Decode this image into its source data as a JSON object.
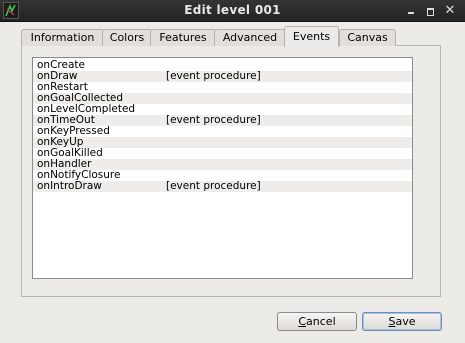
{
  "window": {
    "title": "Edit level 001",
    "icons": [
      "app-icon",
      "minimize-icon",
      "maximize-icon",
      "close-icon"
    ]
  },
  "tabs": [
    {
      "label": "Information",
      "active": false
    },
    {
      "label": "Colors",
      "active": false
    },
    {
      "label": "Features",
      "active": false
    },
    {
      "label": "Advanced",
      "active": false
    },
    {
      "label": "Events",
      "active": true
    },
    {
      "label": "Canvas",
      "active": false
    }
  ],
  "events": [
    {
      "name": "onCreate",
      "procedure": ""
    },
    {
      "name": "onDraw",
      "procedure": "[event procedure]"
    },
    {
      "name": "onRestart",
      "procedure": ""
    },
    {
      "name": "onGoalCollected",
      "procedure": ""
    },
    {
      "name": "onLevelCompleted",
      "procedure": ""
    },
    {
      "name": "onTimeOut",
      "procedure": "[event procedure]"
    },
    {
      "name": "onKeyPressed",
      "procedure": ""
    },
    {
      "name": "onKeyUp",
      "procedure": ""
    },
    {
      "name": "onGoalKilled",
      "procedure": ""
    },
    {
      "name": "onHandler",
      "procedure": ""
    },
    {
      "name": "onNotifyClosure",
      "procedure": ""
    },
    {
      "name": "onIntroDraw",
      "procedure": "[event procedure]"
    }
  ],
  "buttons": {
    "cancel_mnemonic": "C",
    "cancel_rest": "ancel",
    "save_mnemonic": "S",
    "save_rest": "ave"
  }
}
